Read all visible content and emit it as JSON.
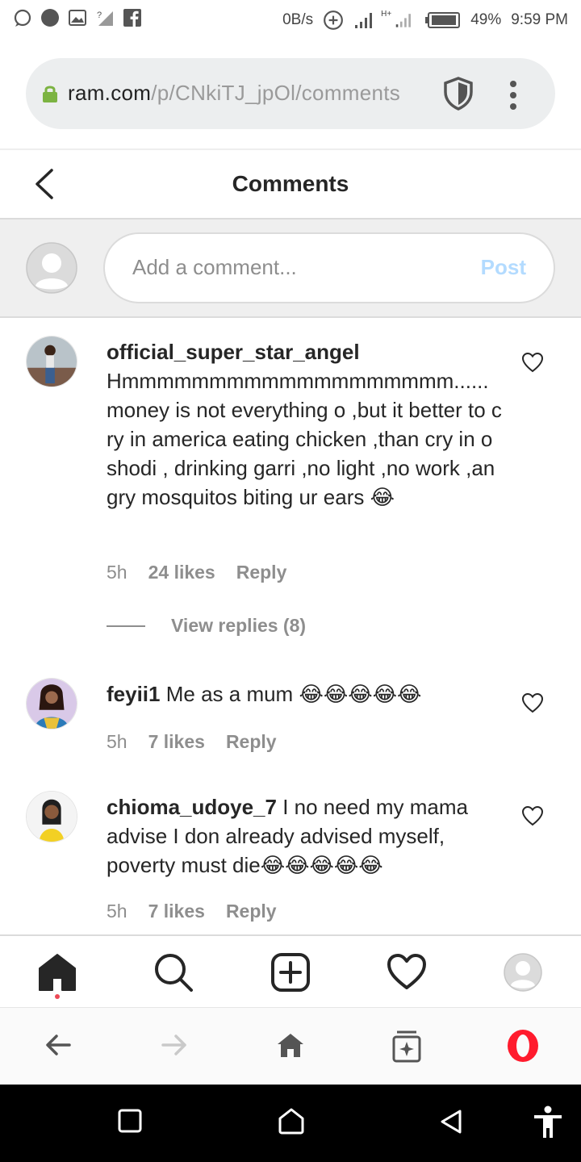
{
  "status_bar": {
    "network_speed": "0B/s",
    "battery_percent": "49%",
    "time": "9:59 PM",
    "network_badge": "H+"
  },
  "browser": {
    "url_domain": "ram.com",
    "url_path": "/p/CNkiTJ_jpOl/comments"
  },
  "header": {
    "title": "Comments"
  },
  "composer": {
    "placeholder": "Add a comment...",
    "post_label": "Post"
  },
  "comments": [
    {
      "username": "official_super_star_angel",
      "text": "Hmmmmmmmmmmmmmmmmmmm......money is not everything o ,but it better to cry in america eating chicken ,than cry in oshodi , drinking garri ,no light ,no work ,angry mosquitos biting ur ears 😂",
      "time": "5h",
      "likes": "24 likes",
      "reply": "Reply",
      "view_replies": "View replies (8)"
    },
    {
      "username": "feyii1",
      "text": "Me as a mum 😂😂😂😂😂",
      "time": "5h",
      "likes": "7 likes",
      "reply": "Reply"
    },
    {
      "username": "chioma_udoye_7",
      "text": "I no need my mama advise I don already advised myself, poverty must die😂😂😂😂😂",
      "time": "5h",
      "likes": "7 likes",
      "reply": "Reply"
    }
  ],
  "colors": {
    "accent_post_disabled": "#b3dbff",
    "notification_dot": "#ed4956",
    "opera_red": "#ff1b2d",
    "lock_green": "#7cb342"
  },
  "icons": {
    "tabbar": [
      "home-icon",
      "search-icon",
      "new-post-icon",
      "activity-heart-icon",
      "profile-avatar-icon"
    ],
    "browser_nav": [
      "back-arrow-icon",
      "forward-arrow-icon",
      "browser-home-icon",
      "tabs-icon",
      "opera-menu-icon"
    ],
    "system_nav": [
      "recents-square-icon",
      "home-circle-icon",
      "back-triangle-icon",
      "accessibility-icon"
    ]
  }
}
